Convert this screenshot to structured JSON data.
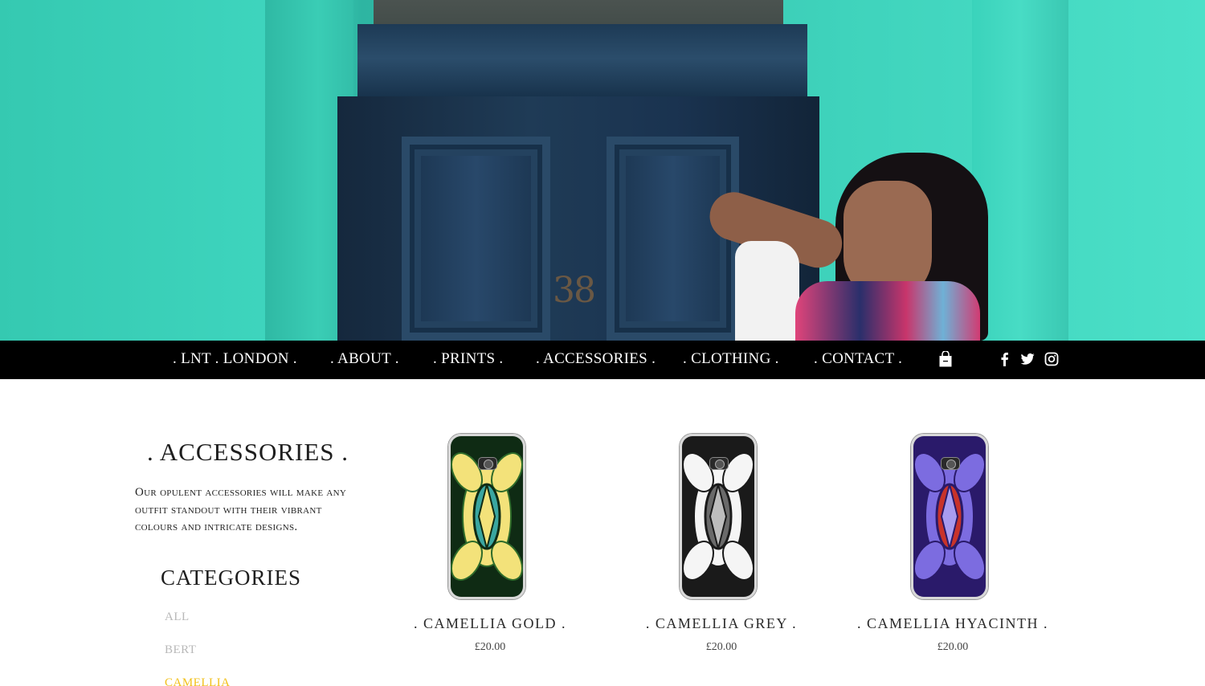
{
  "nav": {
    "items": [
      ". LNT . LONDON .",
      ". ABOUT .",
      ". PRINTS .",
      ". ACCESSORIES .",
      ". CLOTHING .",
      ". CONTACT ."
    ],
    "background": "#000000",
    "text_color": "#ffffff",
    "icons": [
      "shopping-bag-icon",
      "facebook-icon",
      "twitter-icon",
      "instagram-icon"
    ]
  },
  "hero": {
    "door_number": "38"
  },
  "sidebar": {
    "title": ". ACCESSORIES .",
    "description": "Our opulent accessories will make any outfit standout with their vibrant colours and intricate designs.",
    "categories_title": "CATEGORIES",
    "categories": [
      "ALL",
      "BERT",
      "CAMELLIA"
    ],
    "active_category": "CAMELLIA",
    "active_color": "#f2c01a"
  },
  "products": [
    {
      "name": ". CAMELLIA GOLD .",
      "price": "£20.00",
      "case_colors": [
        "#f3e27a",
        "#2e6b2a",
        "#0f2b14",
        "#3aa6a0"
      ]
    },
    {
      "name": ". CAMELLIA GREY .",
      "price": "£20.00",
      "case_colors": [
        "#f5f5f5",
        "#1a1a1a",
        "#6a6a6a",
        "#bdbdbd"
      ]
    },
    {
      "name": ". CAMELLIA HYACINTH .",
      "price": "£20.00",
      "case_colors": [
        "#7c6ce0",
        "#2a1a6a",
        "#c8332a",
        "#a89cf0"
      ]
    }
  ]
}
